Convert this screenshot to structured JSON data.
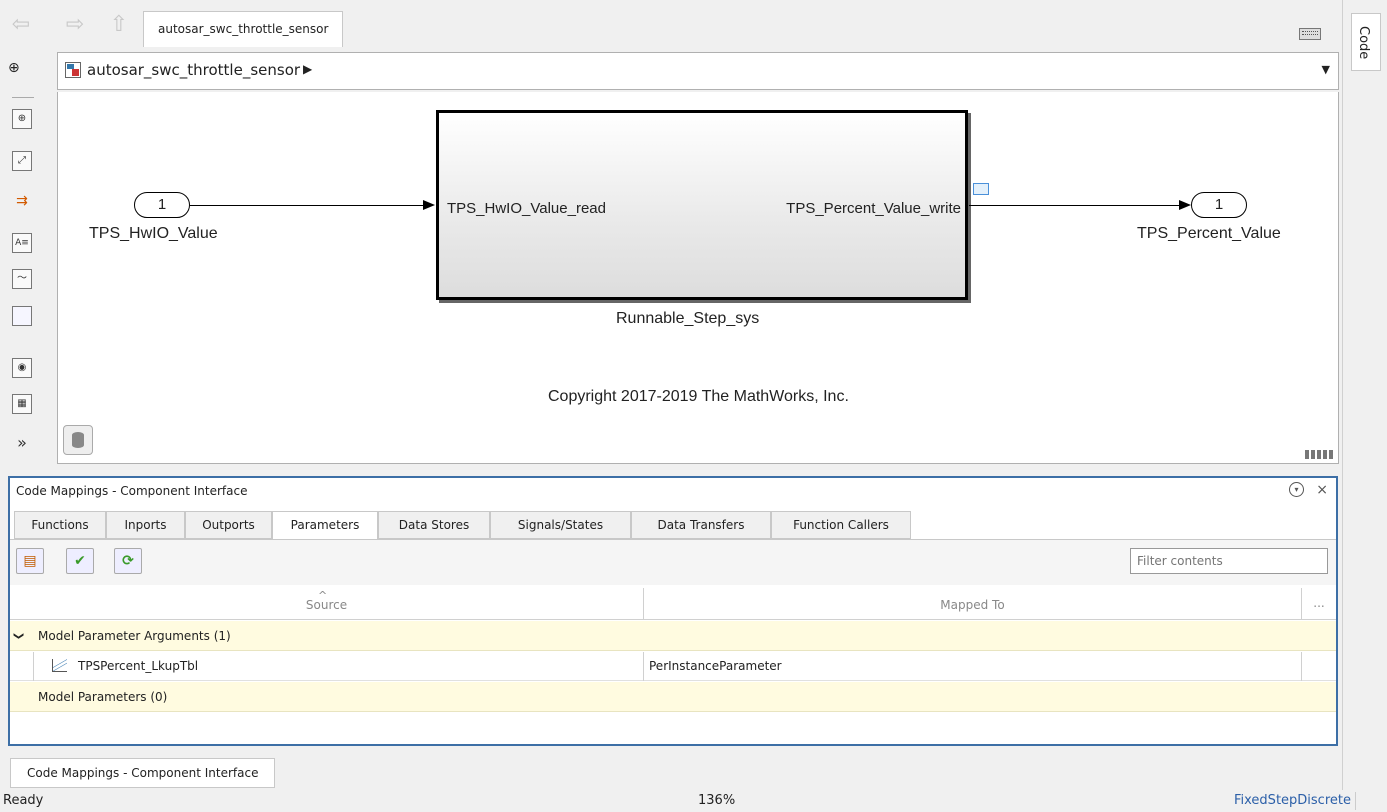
{
  "window": {
    "model_tab": "autosar_swc_throttle_sensor",
    "code_tab": "Code"
  },
  "address": {
    "path": "autosar_swc_throttle_sensor",
    "path_arrow": "▶",
    "dropdown": "▼"
  },
  "nav": {
    "back": "⇦",
    "forward": "⇨",
    "up": "⇧",
    "hide_browser": "⊕"
  },
  "palette": {
    "zoom": "⊕",
    "fit": "⤢",
    "signal": "⇉",
    "annotation": "A≡",
    "image": "〜",
    "area": "",
    "snapshot": "◉",
    "report": "▦",
    "more": "»"
  },
  "diagram": {
    "inport_number": "1",
    "inport_label": "TPS_HwIO_Value",
    "outport_number": "1",
    "outport_label": "TPS_Percent_Value",
    "subsystem_in_port": "TPS_HwIO_Value_read",
    "subsystem_out_port": "TPS_Percent_Value_write",
    "subsystem_name": "Runnable_Step_sys",
    "copyright": "Copyright 2017-2019 The MathWorks, Inc."
  },
  "code_mappings": {
    "title": "Code Mappings - Component Interface",
    "close": "×",
    "options": "▾",
    "tabs": [
      "Functions",
      "Inports",
      "Outports",
      "Parameters",
      "Data Stores",
      "Signals/States",
      "Data Transfers",
      "Function Callers"
    ],
    "active_tab": "Parameters",
    "toolbar": {
      "map_icon": "▤",
      "validate_icon": "✔",
      "refresh_icon": "⟳"
    },
    "filter_placeholder": "Filter contents",
    "columns": {
      "source": "Source",
      "mapped_to": "Mapped To",
      "more": "..."
    },
    "groups": [
      {
        "expand": "❯",
        "label": "Model Parameter Arguments (1)",
        "rows": [
          {
            "source": "TPSPercent_LkupTbl",
            "mapped_to": "PerInstanceParameter"
          }
        ]
      },
      {
        "label": "Model Parameters (0)",
        "rows": []
      }
    ]
  },
  "bottom_tab": "Code Mappings - Component Interface",
  "status": {
    "state": "Ready",
    "zoom": "136%",
    "solver": "FixedStepDiscrete"
  }
}
